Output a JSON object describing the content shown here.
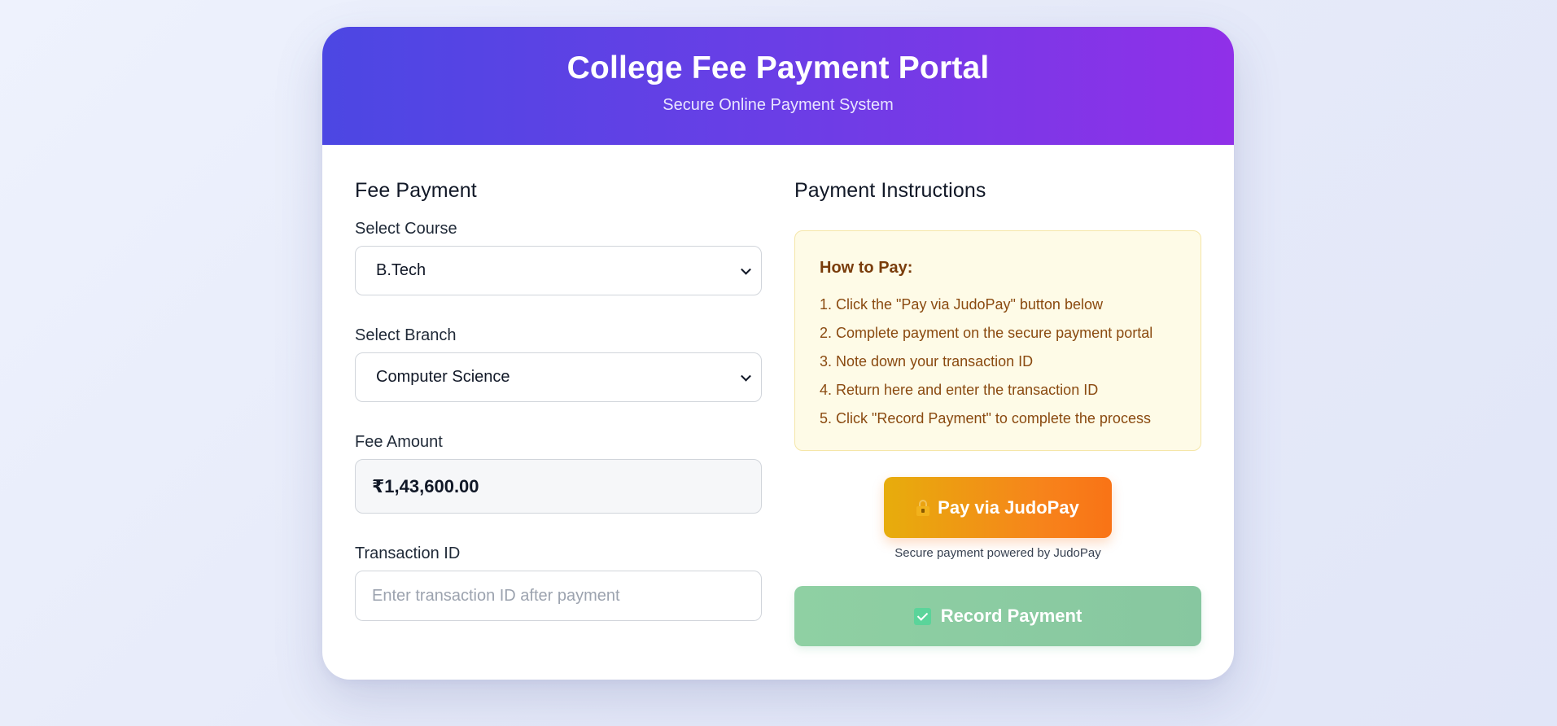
{
  "header": {
    "title": "College Fee Payment Portal",
    "subtitle": "Secure Online Payment System"
  },
  "fee_payment": {
    "section_title": "Fee Payment",
    "course": {
      "label": "Select Course",
      "selected": "B.Tech"
    },
    "branch": {
      "label": "Select Branch",
      "selected": "Computer Science"
    },
    "amount": {
      "label": "Fee Amount",
      "value": "₹1,43,600.00"
    },
    "transaction": {
      "label": "Transaction ID",
      "placeholder": "Enter transaction ID after payment",
      "value": ""
    }
  },
  "instructions": {
    "section_title": "Payment Instructions",
    "box_title": "How to Pay:",
    "steps": [
      "1. Click the \"Pay via JudoPay\" button below",
      "2. Complete payment on the secure payment portal",
      "3. Note down your transaction ID",
      "4. Return here and enter the transaction ID",
      "5. Click \"Record Payment\" to complete the process"
    ]
  },
  "actions": {
    "pay_label": "Pay via JudoPay",
    "pay_icon": "lock-icon",
    "pay_note": "Secure payment powered by JudoPay",
    "record_label": "Record Payment",
    "record_icon": "check-icon"
  },
  "colors": {
    "header_gradient_start": "#4c47e3",
    "header_gradient_end": "#9030e8",
    "pay_button_start": "#e7ad0c",
    "pay_button_end": "#f97316",
    "record_button": "#8fd0a3",
    "instructions_bg": "#fefbe7"
  }
}
